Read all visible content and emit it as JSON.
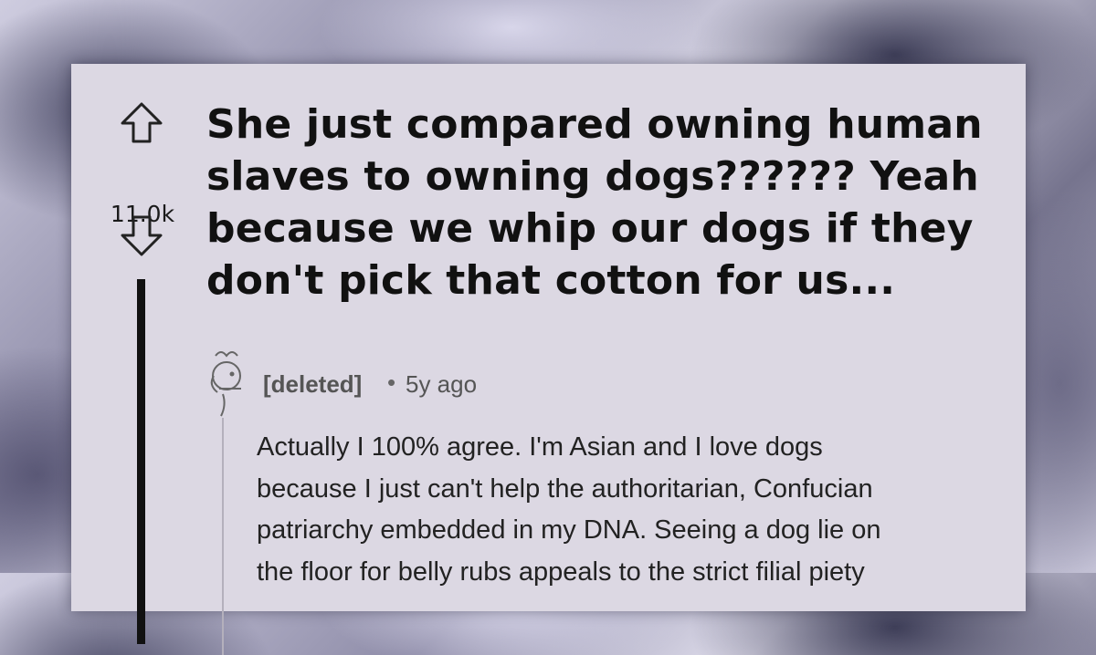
{
  "post": {
    "score": "11.0k",
    "title": "She just compared owning human slaves to owning dogs?????? Yeah because we whip our dogs if they don't pick that cotton for us..."
  },
  "comment": {
    "username": "[deleted]",
    "separator": "•",
    "time": "5y ago",
    "lines": [
      "Actually I 100% agree. I'm Asian and I love dogs",
      "because I just can't help the authoritarian, Confucian",
      "patriarchy embedded in my DNA. Seeing a dog lie on",
      "the floor for belly rubs appeals to the strict filial piety"
    ]
  },
  "icons": {
    "upvote": "upvote-arrow-icon",
    "downvote": "downvote-arrow-icon",
    "avatar": "deleted-user-avatar-icon"
  }
}
